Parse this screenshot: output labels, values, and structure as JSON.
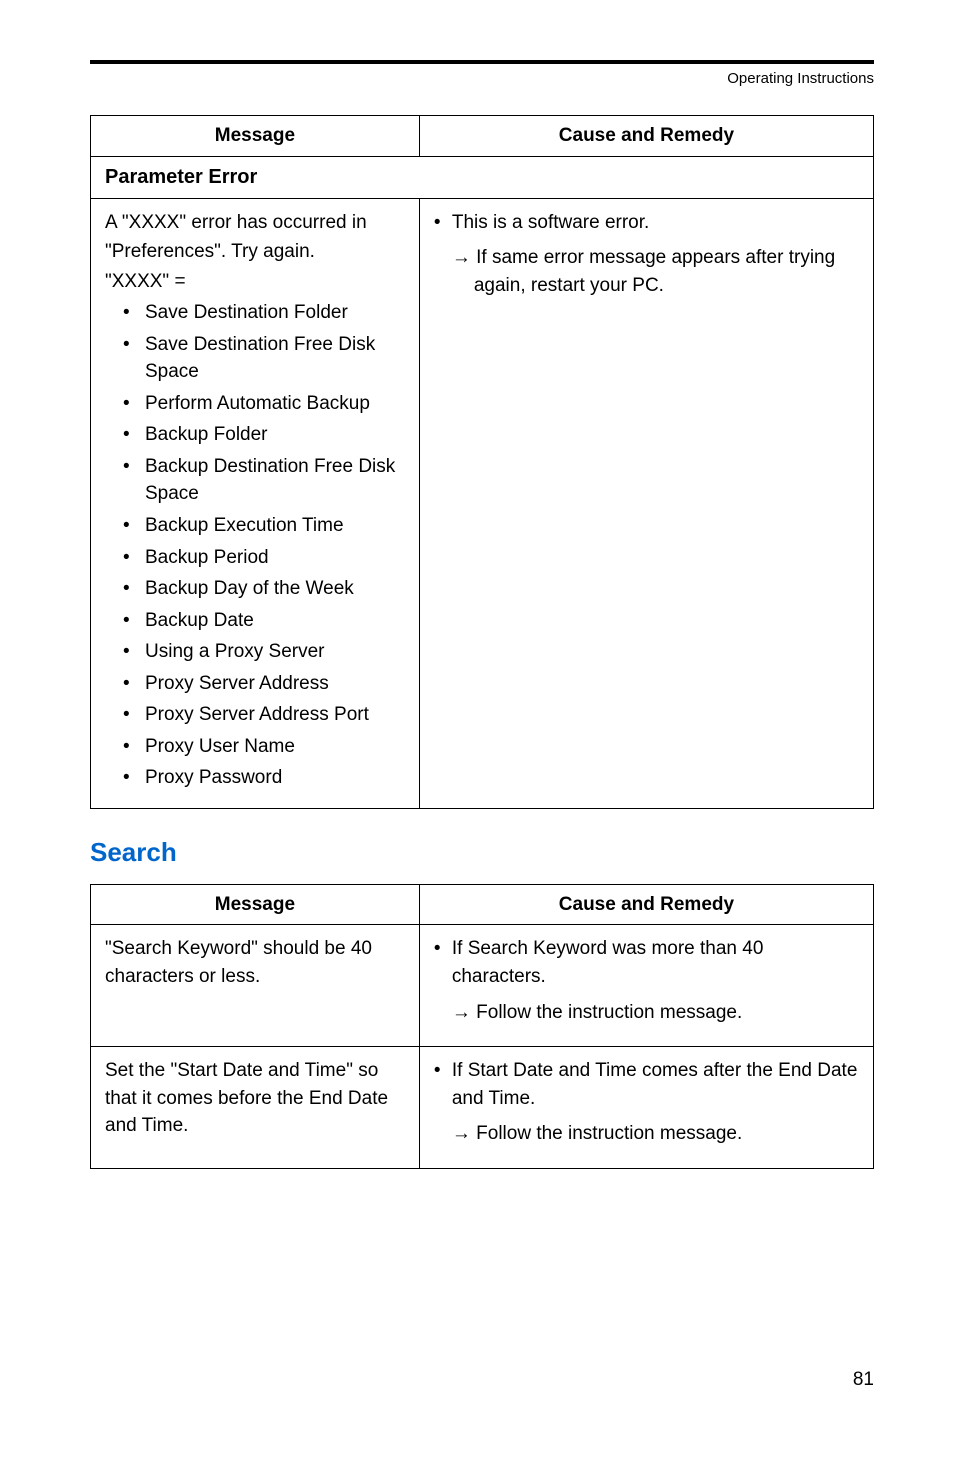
{
  "header": "Operating Instructions",
  "table1": {
    "col1": "Message",
    "col2": "Cause and Remedy",
    "section": "Parameter Error",
    "msg": {
      "line1": "A \"XXXX\" error has occurred in",
      "line2": "\"Preferences\". Try again.",
      "line3": "\"XXXX\" =",
      "items": [
        "Save Destination Folder",
        "Save Destination Free Disk Space",
        "Perform Automatic Backup",
        "Backup Folder",
        "Backup Destination Free Disk Space",
        "Backup Execution Time",
        "Backup Period",
        "Backup Day of the Week",
        "Backup Date",
        "Using a Proxy Server",
        "Proxy Server Address",
        "Proxy Server Address Port",
        "Proxy User Name",
        "Proxy Password"
      ]
    },
    "cause": {
      "bullet": "This is a software error.",
      "arrow": "If same error message appears after trying again, restart your PC."
    }
  },
  "searchTitle": "Search",
  "table2": {
    "col1": "Message",
    "col2": "Cause and Remedy",
    "row1": {
      "msg": "\"Search Keyword\" should be 40 characters or less.",
      "bullet": "If Search Keyword was more than 40 characters.",
      "arrow": "Follow the instruction message."
    },
    "row2": {
      "msg": "Set the \"Start Date and Time\" so that it comes before the End Date and Time.",
      "bullet": "If Start Date and Time comes after the End Date and Time.",
      "arrow": "Follow the instruction message."
    }
  },
  "pageNumber": "81"
}
